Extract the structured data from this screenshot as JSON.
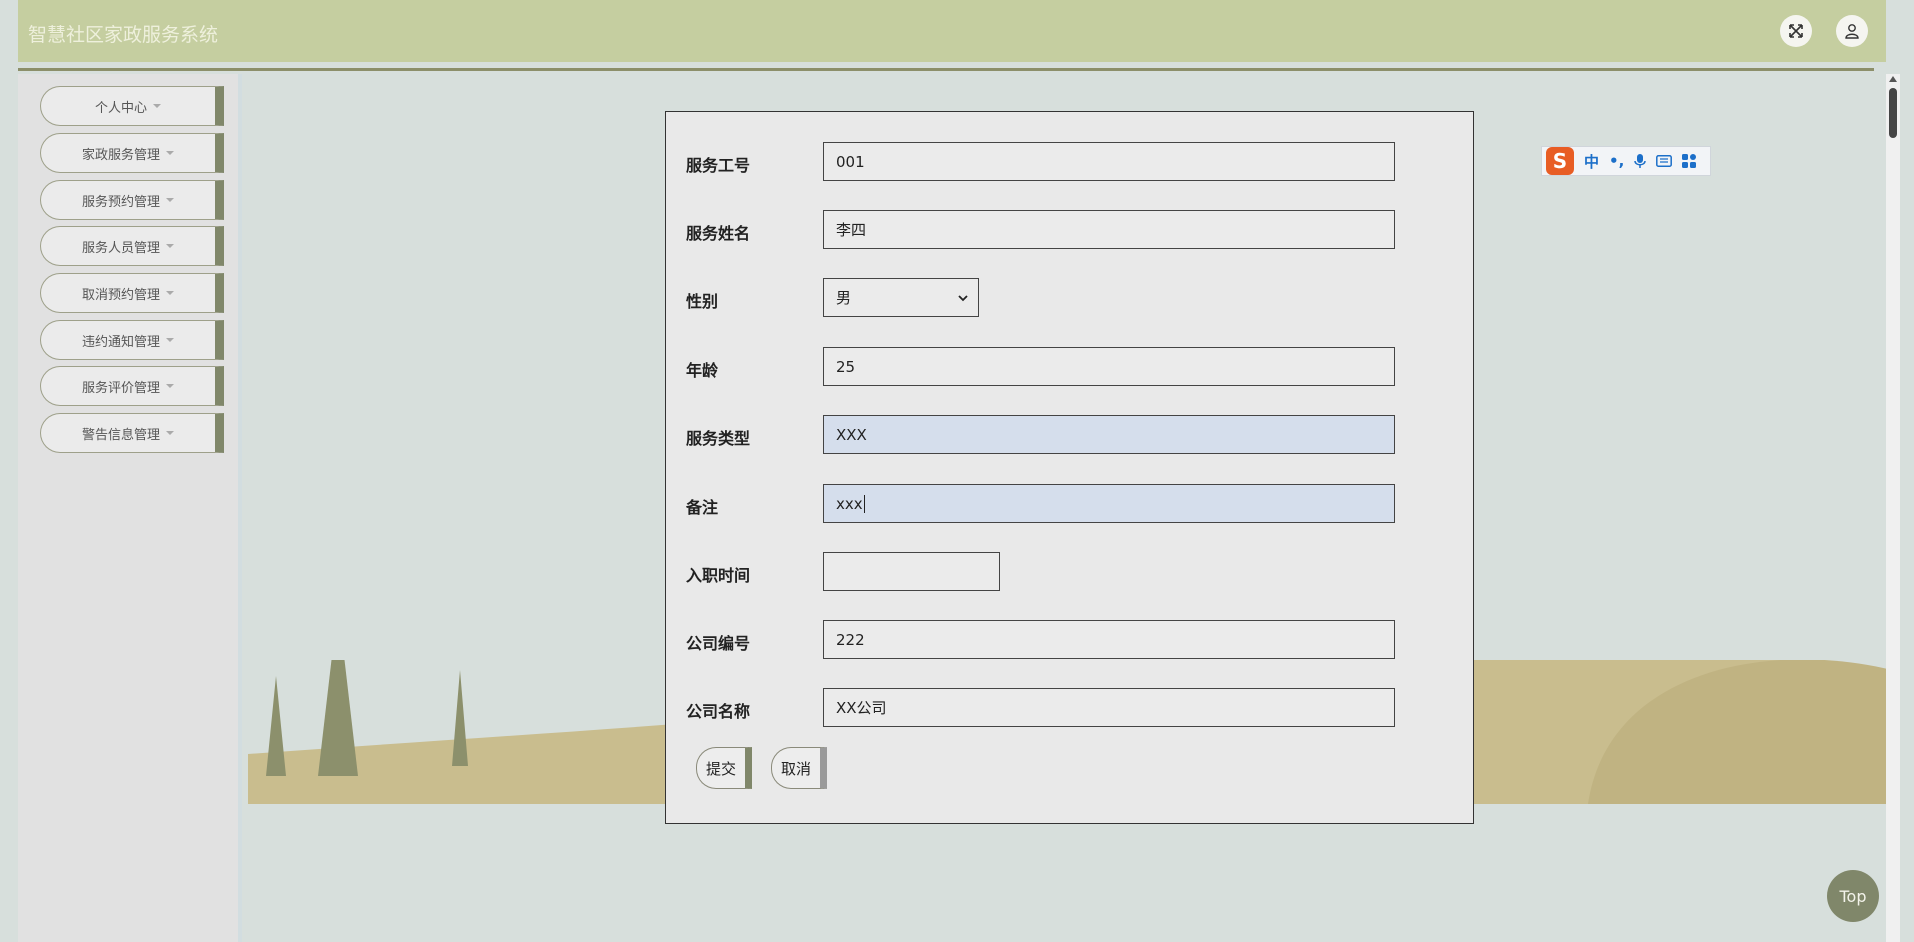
{
  "app": {
    "title": "智慧社区家政服务系统"
  },
  "header": {
    "fullscreen_icon": "expand-icon",
    "user_icon": "user-icon"
  },
  "sidebar": {
    "items": [
      {
        "label": "个人中心"
      },
      {
        "label": "家政服务管理"
      },
      {
        "label": "服务预约管理"
      },
      {
        "label": "服务人员管理"
      },
      {
        "label": "取消预约管理"
      },
      {
        "label": "违约通知管理"
      },
      {
        "label": "服务评价管理"
      },
      {
        "label": "警告信息管理"
      }
    ]
  },
  "form": {
    "fields": {
      "service_id": {
        "label": "服务工号",
        "value": "001"
      },
      "service_name": {
        "label": "服务姓名",
        "value": "李四"
      },
      "gender": {
        "label": "性别",
        "value": "男"
      },
      "age": {
        "label": "年龄",
        "value": "25"
      },
      "service_type": {
        "label": "服务类型",
        "value": "XXX"
      },
      "remark": {
        "label": "备注",
        "value": "xxx"
      },
      "hire_date": {
        "label": "入职时间",
        "value": ""
      },
      "company_code": {
        "label": "公司编号",
        "value": "222"
      },
      "company_name": {
        "label": "公司名称",
        "value": "XX公司"
      }
    },
    "submit_label": "提交",
    "cancel_label": "取消"
  },
  "ime_toolbar": {
    "logo": "S",
    "mode": "中",
    "punct": "•,",
    "icons": [
      "mic-icon",
      "keyboard-icon",
      "grid-icon"
    ]
  },
  "top_button": {
    "label": "Top"
  },
  "colors": {
    "header_bg": "#c5cea0",
    "accent": "#80876a",
    "page_bg": "#d7dfdc",
    "sand": "#c9bd8e"
  }
}
